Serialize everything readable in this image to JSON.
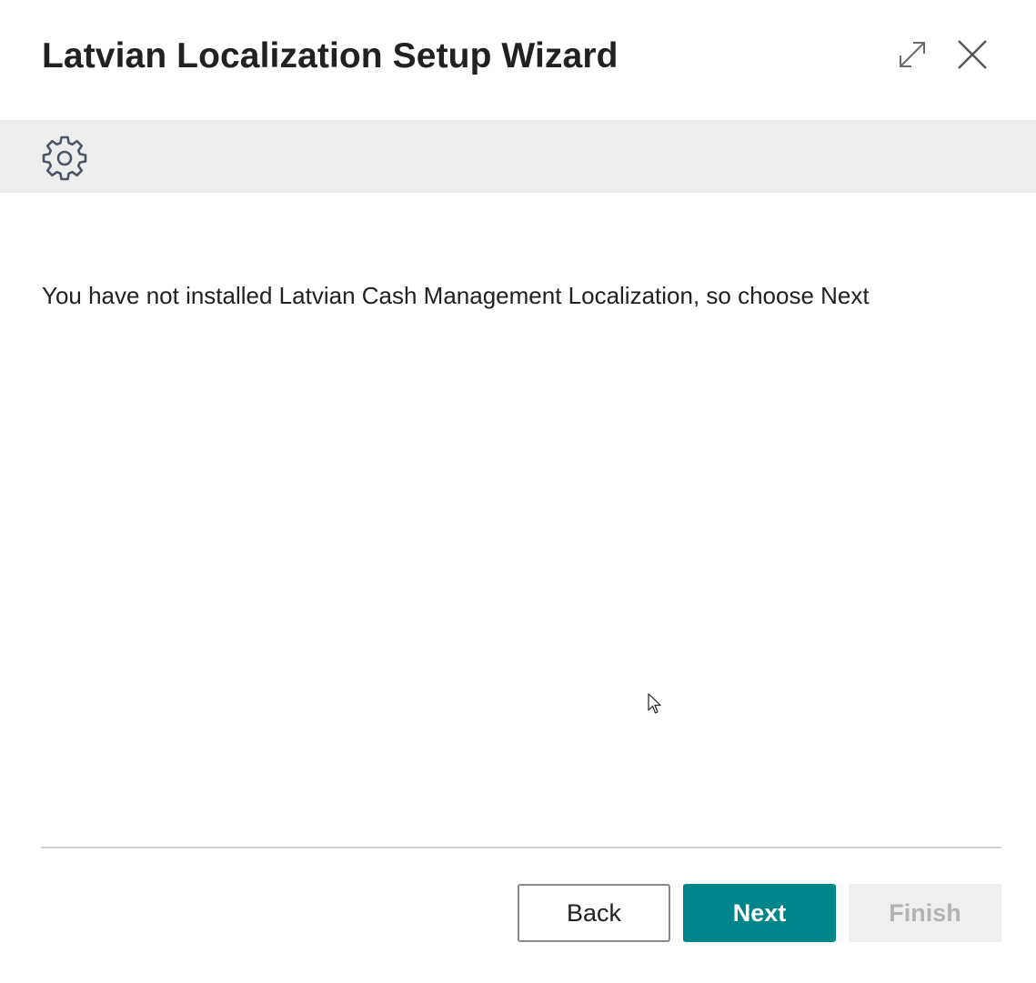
{
  "dialog": {
    "title": "Latvian Localization Setup Wizard",
    "icons": {
      "expand": "expand-icon",
      "close": "close-icon",
      "banner": "gear-icon"
    }
  },
  "content": {
    "message": "You have not installed Latvian Cash Management Localization, so choose Next"
  },
  "footer": {
    "back_label": "Back",
    "next_label": "Next",
    "finish_label": "Finish",
    "finish_enabled": false
  },
  "colors": {
    "accent": "#00868a",
    "banner_bg": "#eeeeee",
    "disabled_bg": "#efefef",
    "disabled_text": "#b3b3b3"
  }
}
